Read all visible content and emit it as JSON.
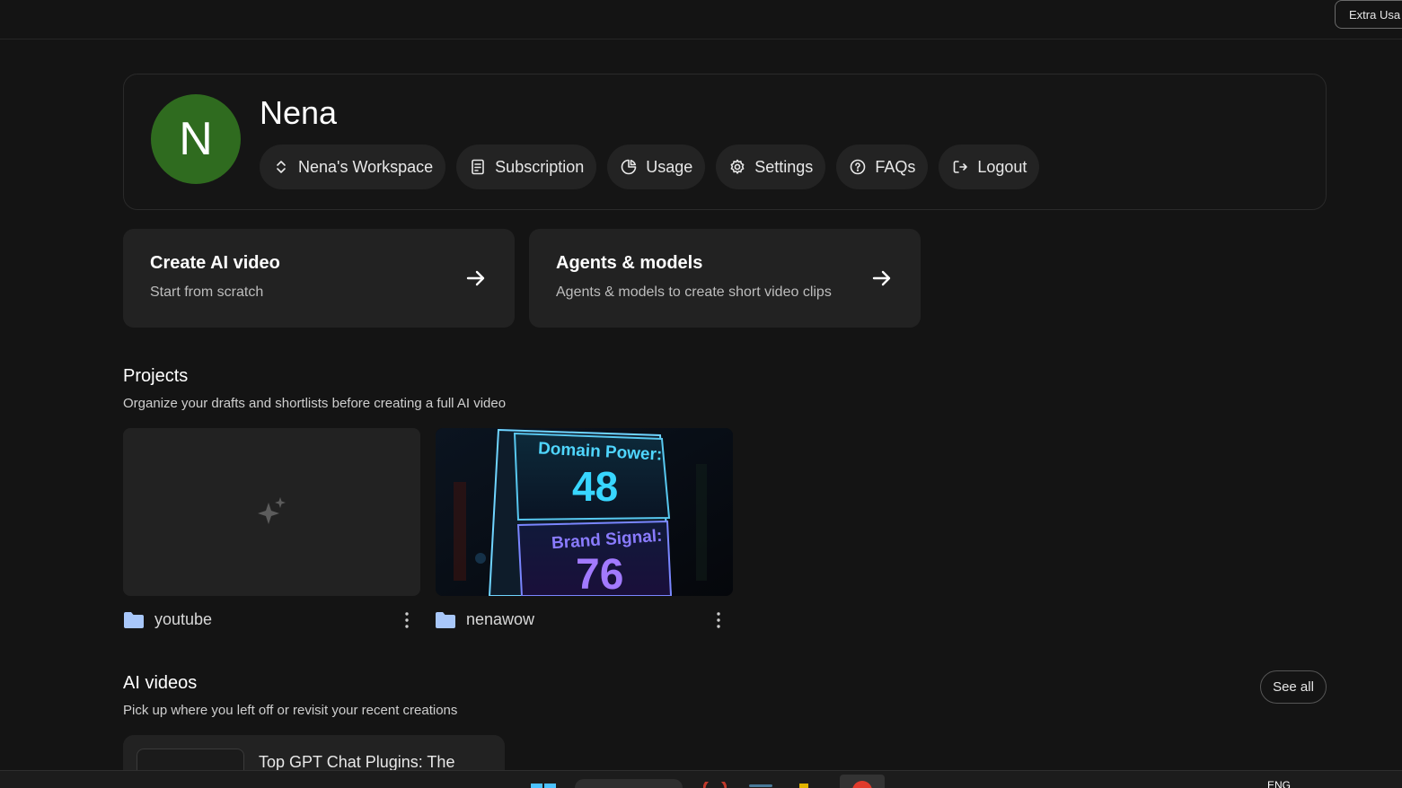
{
  "topbar": {
    "extra_label": "Extra Usa"
  },
  "profile": {
    "initial": "N",
    "name": "Nena",
    "avatar_color": "#2f6b1f",
    "pills": [
      {
        "label": "Nena's Workspace",
        "icon": "chevron-updown-icon"
      },
      {
        "label": "Subscription",
        "icon": "receipt-icon"
      },
      {
        "label": "Usage",
        "icon": "pie-chart-icon"
      },
      {
        "label": "Settings",
        "icon": "gear-icon"
      },
      {
        "label": "FAQs",
        "icon": "help-circle-icon"
      },
      {
        "label": "Logout",
        "icon": "logout-icon"
      }
    ]
  },
  "actions": [
    {
      "title": "Create AI video",
      "subtitle": "Start from scratch"
    },
    {
      "title": "Agents & models",
      "subtitle": "Agents & models to create short video clips"
    }
  ],
  "projects": {
    "title": "Projects",
    "subtitle": "Organize your drafts and shortlists before creating a full AI video",
    "items": [
      {
        "name": "youtube",
        "thumbnail": "empty-sparkle"
      },
      {
        "name": "nenawow",
        "thumbnail": "image",
        "thumb_text": {
          "line1_label": "Domain Power:",
          "line1_value": "48",
          "line2_label": "Brand Signal:",
          "line2_value": "76"
        }
      }
    ]
  },
  "ai_videos": {
    "title": "AI videos",
    "subtitle": "Pick up where you left off or revisit your recent creations",
    "see_all": "See all",
    "items": [
      {
        "title": "Top GPT Chat Plugins: The"
      }
    ]
  },
  "taskbar": {
    "lang": "ENG"
  },
  "colors": {
    "background": "#141414",
    "card": "#222222",
    "folder": "#a8c7fa",
    "accent_cyan": "#38d6ff",
    "accent_purple": "#9b6bff"
  }
}
